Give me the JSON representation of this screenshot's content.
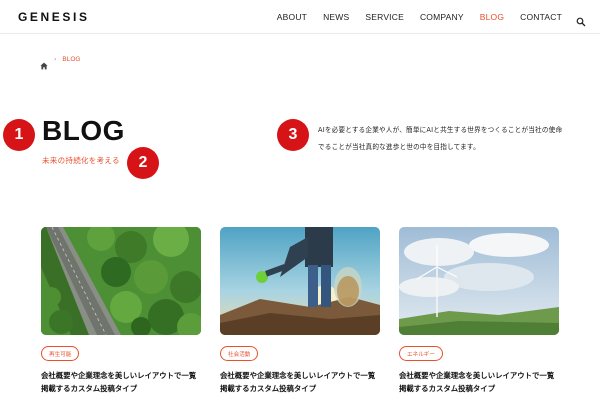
{
  "site": {
    "logo": "GENESIS"
  },
  "nav": {
    "items": [
      "ABOUT",
      "NEWS",
      "SERVICE",
      "COMPANY",
      "BLOG",
      "CONTACT"
    ],
    "active_index": 4,
    "search_icon": "search-icon"
  },
  "breadcrumb": {
    "home_icon": "home-icon",
    "separator": "›",
    "current": "BLOG"
  },
  "hero": {
    "title": "BLOG",
    "subtitle": "未来の持続化を考える",
    "description_lines": [
      "AIを必要とする企業や人が、簡単にAIと共生する世界をつくることが当社の使命",
      "でることが当社真的な進歩と世の中を目指してます。"
    ]
  },
  "markers": [
    "1",
    "2",
    "3"
  ],
  "colors": {
    "accent": "#e8502d",
    "marker": "#d61418"
  },
  "cards": [
    {
      "tag": "再生可能",
      "title_lines": [
        "会社概要や企業理念を美しいレイアウトで一覧",
        "掲載するカスタム投稿タイプ"
      ],
      "image": "aerial-forest-road"
    },
    {
      "tag": "社会活動",
      "title_lines": [
        "会社概要や企業理念を美しいレイアウトで一覧",
        "掲載するカスタム投稿タイプ"
      ],
      "image": "volunteer-collecting-trash"
    },
    {
      "tag": "エネルギー",
      "title_lines": [
        "会社概要や企業理念を美しいレイアウトで一覧",
        "掲載するカスタム投稿タイプ"
      ],
      "image": "wind-turbine-hill"
    }
  ]
}
